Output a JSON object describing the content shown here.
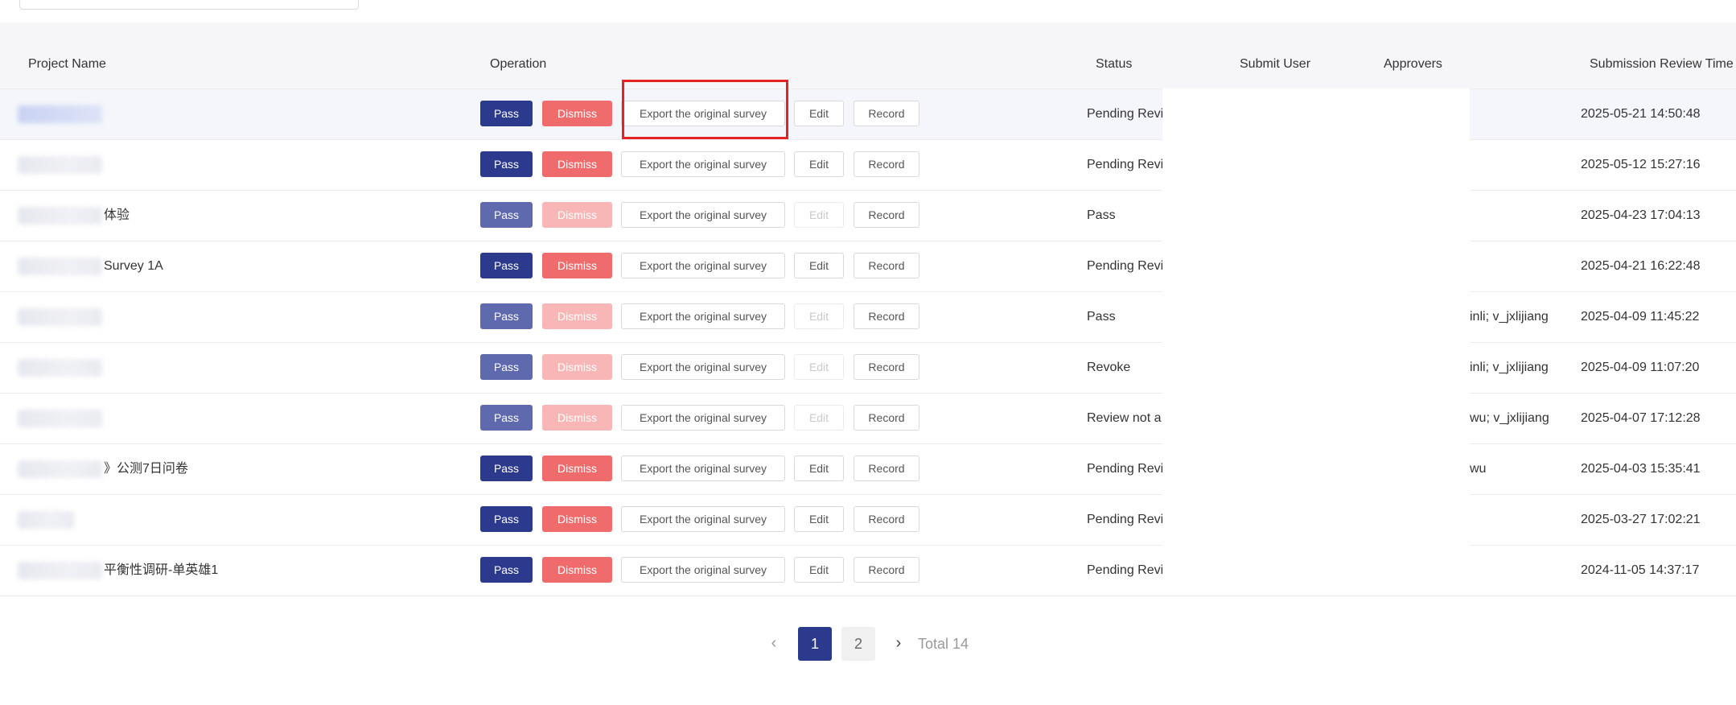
{
  "table": {
    "headers": {
      "project_name": "Project Name",
      "operation": "Operation",
      "status": "Status",
      "submit_user": "Submit User",
      "approvers": "Approvers",
      "submission_review_time": "Submission Review Time"
    },
    "buttons": {
      "pass": "Pass",
      "dismiss": "Dismiss",
      "export": "Export the original survey",
      "edit": "Edit",
      "record": "Record"
    },
    "rows": [
      {
        "project_suffix": "",
        "status": "Pending Revi",
        "approvers_suffix": "",
        "time": "2025-05-21 14:50:48",
        "enabled": true
      },
      {
        "project_suffix": "",
        "status": "Pending Revi",
        "approvers_suffix": "",
        "time": "2025-05-12 15:27:16",
        "enabled": true
      },
      {
        "project_suffix": "体验",
        "status": "Pass",
        "approvers_suffix": "",
        "time": "2025-04-23 17:04:13",
        "enabled": false
      },
      {
        "project_suffix": "Survey 1A",
        "status": "Pending Revi",
        "approvers_suffix": "",
        "time": "2025-04-21 16:22:48",
        "enabled": true
      },
      {
        "project_suffix": "",
        "status": "Pass",
        "approvers_suffix": "inli; v_jxlijiang",
        "time": "2025-04-09 11:45:22",
        "enabled": false
      },
      {
        "project_suffix": "",
        "status": "Revoke",
        "approvers_suffix": "inli; v_jxlijiang",
        "time": "2025-04-09 11:07:20",
        "enabled": false
      },
      {
        "project_suffix": "",
        "status": "Review not a",
        "approvers_suffix": "wu; v_jxlijiang",
        "time": "2025-04-07 17:12:28",
        "enabled": false
      },
      {
        "project_suffix": "》公测7日问卷",
        "status": "Pending Revi",
        "approvers_suffix": "wu",
        "time": "2025-04-03 15:35:41",
        "enabled": true
      },
      {
        "project_suffix": "",
        "status": "Pending Revi",
        "approvers_suffix": "",
        "time": "2025-03-27 17:02:21",
        "enabled": true
      },
      {
        "project_suffix": "平衡性调研-单英雄1",
        "status": "Pending Revi",
        "approvers_suffix": "",
        "time": "2024-11-05 14:37:17",
        "enabled": true
      }
    ]
  },
  "pagination": {
    "prev_icon": "chevron-left-icon",
    "next_icon": "chevron-right-icon",
    "pages": [
      "1",
      "2"
    ],
    "current_page": "1",
    "total_label": "Total 14"
  },
  "colors": {
    "primary": "#2b3a8c",
    "danger": "#f06b6b",
    "highlight_box": "#e52323"
  }
}
